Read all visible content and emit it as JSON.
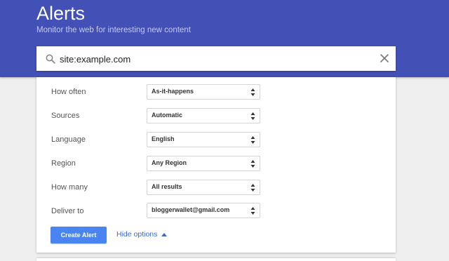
{
  "header": {
    "title": "Alerts",
    "subtitle": "Monitor the web for interesting new content",
    "background_color": "#4350b5"
  },
  "search": {
    "value": "site:example.com",
    "icon": "search-icon",
    "clear_icon": "close-icon"
  },
  "options": [
    {
      "label": "How often",
      "value": "As-it-happens"
    },
    {
      "label": "Sources",
      "value": "Automatic"
    },
    {
      "label": "Language",
      "value": "English"
    },
    {
      "label": "Region",
      "value": "Any Region"
    },
    {
      "label": "How many",
      "value": "All results"
    },
    {
      "label": "Deliver to",
      "value": "bloggerwallet@gmail.com"
    }
  ],
  "actions": {
    "create_label": "Create Alert",
    "hide_options_label": "Hide options",
    "accent_color": "#4a84f0"
  }
}
